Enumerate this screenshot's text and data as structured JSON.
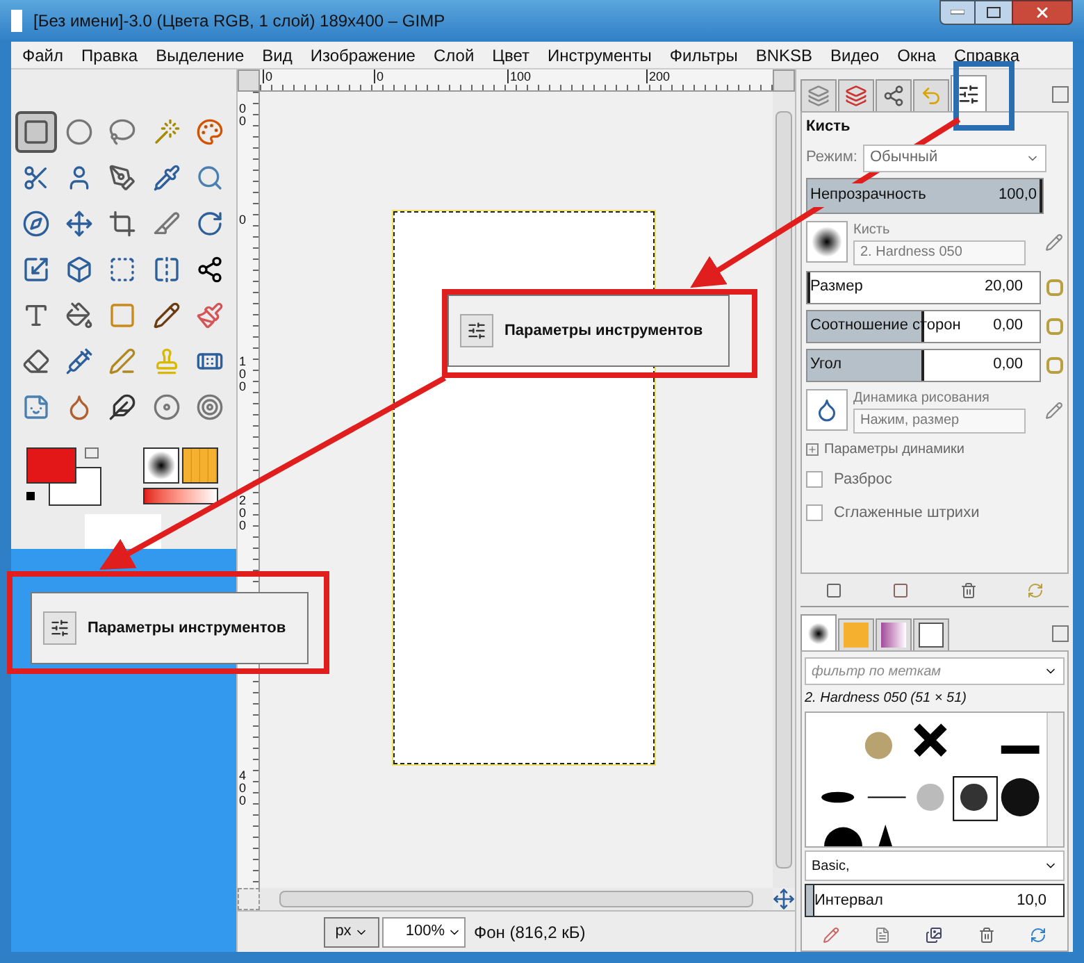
{
  "window": {
    "title": "[Без имени]-3.0 (Цвета RGB, 1 слой) 189x400 – GIMP"
  },
  "menu": [
    "Файл",
    "Правка",
    "Выделение",
    "Вид",
    "Изображение",
    "Слой",
    "Цвет",
    "Инструменты",
    "Фильтры",
    "BNKSB",
    "Видео",
    "Окна",
    "Справка"
  ],
  "toolbox": {
    "tools": [
      {
        "selected": true
      },
      {
        "selected": false
      },
      {
        "selected": false
      },
      {
        "selected": false
      },
      {
        "selected": false
      },
      {
        "selected": false
      },
      {
        "selected": false
      },
      {
        "selected": false
      },
      {
        "selected": false
      },
      {
        "selected": false
      },
      {
        "selected": false
      },
      {
        "selected": false
      },
      {
        "selected": false
      },
      {
        "selected": false
      },
      {
        "selected": false
      },
      {
        "selected": false
      },
      {
        "selected": false
      },
      {
        "selected": false
      },
      {
        "selected": false
      },
      {
        "selected": false
      },
      {
        "selected": false
      },
      {
        "selected": false
      },
      {
        "selected": false
      },
      {
        "selected": false
      },
      {
        "selected": false
      },
      {
        "selected": false
      },
      {
        "selected": false
      },
      {
        "selected": false
      },
      {
        "selected": false
      },
      {
        "selected": false
      },
      {
        "selected": false
      },
      {
        "selected": false
      },
      {
        "selected": false
      },
      {
        "selected": false
      },
      {
        "selected": false
      }
    ]
  },
  "canvas": {
    "top_ruler": [
      "0",
      "0",
      "100",
      "200"
    ],
    "left_ruler": [
      "00",
      "0",
      "100",
      "200",
      "400"
    ]
  },
  "status_bar": {
    "unit": "px",
    "zoom": "100%",
    "layer": "Фон (816,2 кБ)"
  },
  "tool_options": {
    "tabs": [
      {
        "selected": false
      },
      {
        "selected": false
      },
      {
        "selected": false
      },
      {
        "selected": false
      },
      {
        "selected": true
      }
    ],
    "title": "Кисть",
    "mode_label": "Режим:",
    "mode": "Обычный",
    "opacity": {
      "label": "Непрозрачность",
      "value": "100,0",
      "level": 1
    },
    "brush_label": "Кисть",
    "brush": "2. Hardness 050",
    "sliders": [
      {
        "label": "Размер",
        "value": "20,00",
        "level": 0.01
      },
      {
        "label": "Соотношение сторон",
        "value": "0,00",
        "level": 0.5
      },
      {
        "label": "Угол",
        "value": "0,00",
        "level": 0.5
      }
    ],
    "dynamics_label": "Динамика рисования",
    "dynamics": "Нажим, размер",
    "dynamics_options": {
      "label": "Параметры динамики",
      "expanded": false
    },
    "checkboxes": [
      {
        "label": "Разброс",
        "checked": false
      },
      {
        "label": "Сглаженные штрихи",
        "checked": false
      }
    ]
  },
  "brushes": {
    "tabs": [
      {
        "selected": true
      },
      {
        "selected": false
      },
      {
        "selected": false
      },
      {
        "selected": false
      }
    ],
    "filter_placeholder": "фильтр по меткам",
    "current": "2. Hardness 050 (51 × 51)",
    "preset": "Basic,",
    "spacing": {
      "label": "Интервал",
      "value": "10,0",
      "level": 0.03
    }
  },
  "tooltips": [
    {
      "text": "Параметры инструментов"
    },
    {
      "text": "Параметры инструментов"
    }
  ]
}
